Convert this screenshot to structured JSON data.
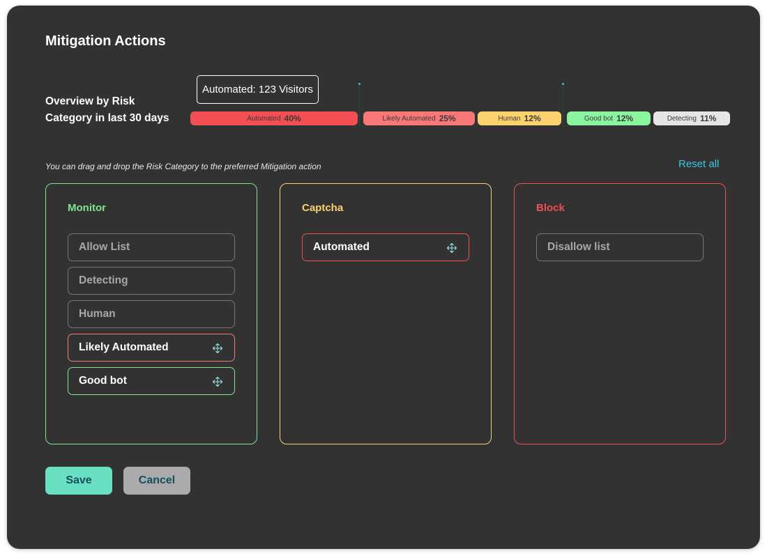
{
  "title": "Mitigation Actions",
  "overview": {
    "label": "Overview by Risk Category in last 30 days",
    "tooltip": "Automated: 123 Visitors",
    "segments": [
      {
        "label": "Automated",
        "percent": "40%",
        "value": 40,
        "color": "#f24e54"
      },
      {
        "label": "Likely Automated",
        "percent": "25%",
        "value": 25,
        "color": "#f87878"
      },
      {
        "label": "Human",
        "percent": "12%",
        "value": 12,
        "color": "#fcd26e"
      },
      {
        "label": "Good bot",
        "percent": "12%",
        "value": 12,
        "color": "#8af59e"
      },
      {
        "label": "Detecting",
        "percent": "11%",
        "value": 11,
        "color": "#e6e6e6"
      }
    ]
  },
  "hint": "You can drag and drop the Risk Category to the preferred Mitigation action",
  "reset_label": "Reset all",
  "colors": {
    "monitor": "#7ee68c",
    "captcha": "#fcd26e",
    "block": "#f24e54",
    "accent": "#3cc6e3",
    "drag_icon": "#8fd6d6"
  },
  "columns": [
    {
      "title": "Monitor",
      "items": [
        {
          "label": "Allow List",
          "state": "disabled"
        },
        {
          "label": "Detecting",
          "state": "disabled"
        },
        {
          "label": "Human",
          "state": "disabled"
        },
        {
          "label": "Likely Automated",
          "state": "draggable",
          "border": "#f87878"
        },
        {
          "label": "Good bot",
          "state": "draggable",
          "border": "#7ee68c"
        }
      ]
    },
    {
      "title": "Captcha",
      "items": [
        {
          "label": "Automated",
          "state": "draggable",
          "border": "#f24e54"
        }
      ]
    },
    {
      "title": "Block",
      "items": [
        {
          "label": "Disallow list",
          "state": "disabled"
        }
      ]
    }
  ],
  "buttons": {
    "save": "Save",
    "cancel": "Cancel"
  }
}
